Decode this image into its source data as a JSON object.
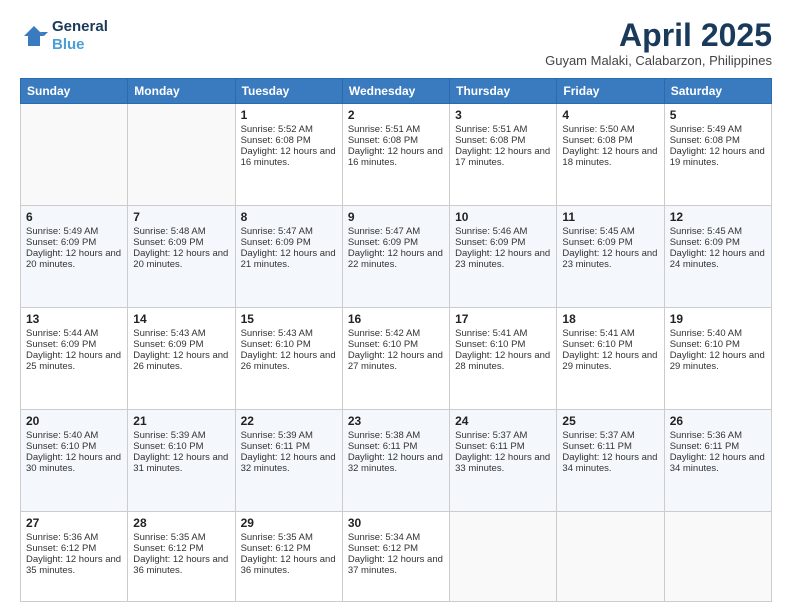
{
  "header": {
    "logo_line1": "General",
    "logo_line2": "Blue",
    "month": "April 2025",
    "location": "Guyam Malaki, Calabarzon, Philippines"
  },
  "days_of_week": [
    "Sunday",
    "Monday",
    "Tuesday",
    "Wednesday",
    "Thursday",
    "Friday",
    "Saturday"
  ],
  "weeks": [
    [
      {
        "day": "",
        "info": ""
      },
      {
        "day": "",
        "info": ""
      },
      {
        "day": "1",
        "info": "Sunrise: 5:52 AM\nSunset: 6:08 PM\nDaylight: 12 hours and 16 minutes."
      },
      {
        "day": "2",
        "info": "Sunrise: 5:51 AM\nSunset: 6:08 PM\nDaylight: 12 hours and 16 minutes."
      },
      {
        "day": "3",
        "info": "Sunrise: 5:51 AM\nSunset: 6:08 PM\nDaylight: 12 hours and 17 minutes."
      },
      {
        "day": "4",
        "info": "Sunrise: 5:50 AM\nSunset: 6:08 PM\nDaylight: 12 hours and 18 minutes."
      },
      {
        "day": "5",
        "info": "Sunrise: 5:49 AM\nSunset: 6:08 PM\nDaylight: 12 hours and 19 minutes."
      }
    ],
    [
      {
        "day": "6",
        "info": "Sunrise: 5:49 AM\nSunset: 6:09 PM\nDaylight: 12 hours and 20 minutes."
      },
      {
        "day": "7",
        "info": "Sunrise: 5:48 AM\nSunset: 6:09 PM\nDaylight: 12 hours and 20 minutes."
      },
      {
        "day": "8",
        "info": "Sunrise: 5:47 AM\nSunset: 6:09 PM\nDaylight: 12 hours and 21 minutes."
      },
      {
        "day": "9",
        "info": "Sunrise: 5:47 AM\nSunset: 6:09 PM\nDaylight: 12 hours and 22 minutes."
      },
      {
        "day": "10",
        "info": "Sunrise: 5:46 AM\nSunset: 6:09 PM\nDaylight: 12 hours and 23 minutes."
      },
      {
        "day": "11",
        "info": "Sunrise: 5:45 AM\nSunset: 6:09 PM\nDaylight: 12 hours and 23 minutes."
      },
      {
        "day": "12",
        "info": "Sunrise: 5:45 AM\nSunset: 6:09 PM\nDaylight: 12 hours and 24 minutes."
      }
    ],
    [
      {
        "day": "13",
        "info": "Sunrise: 5:44 AM\nSunset: 6:09 PM\nDaylight: 12 hours and 25 minutes."
      },
      {
        "day": "14",
        "info": "Sunrise: 5:43 AM\nSunset: 6:09 PM\nDaylight: 12 hours and 26 minutes."
      },
      {
        "day": "15",
        "info": "Sunrise: 5:43 AM\nSunset: 6:10 PM\nDaylight: 12 hours and 26 minutes."
      },
      {
        "day": "16",
        "info": "Sunrise: 5:42 AM\nSunset: 6:10 PM\nDaylight: 12 hours and 27 minutes."
      },
      {
        "day": "17",
        "info": "Sunrise: 5:41 AM\nSunset: 6:10 PM\nDaylight: 12 hours and 28 minutes."
      },
      {
        "day": "18",
        "info": "Sunrise: 5:41 AM\nSunset: 6:10 PM\nDaylight: 12 hours and 29 minutes."
      },
      {
        "day": "19",
        "info": "Sunrise: 5:40 AM\nSunset: 6:10 PM\nDaylight: 12 hours and 29 minutes."
      }
    ],
    [
      {
        "day": "20",
        "info": "Sunrise: 5:40 AM\nSunset: 6:10 PM\nDaylight: 12 hours and 30 minutes."
      },
      {
        "day": "21",
        "info": "Sunrise: 5:39 AM\nSunset: 6:10 PM\nDaylight: 12 hours and 31 minutes."
      },
      {
        "day": "22",
        "info": "Sunrise: 5:39 AM\nSunset: 6:11 PM\nDaylight: 12 hours and 32 minutes."
      },
      {
        "day": "23",
        "info": "Sunrise: 5:38 AM\nSunset: 6:11 PM\nDaylight: 12 hours and 32 minutes."
      },
      {
        "day": "24",
        "info": "Sunrise: 5:37 AM\nSunset: 6:11 PM\nDaylight: 12 hours and 33 minutes."
      },
      {
        "day": "25",
        "info": "Sunrise: 5:37 AM\nSunset: 6:11 PM\nDaylight: 12 hours and 34 minutes."
      },
      {
        "day": "26",
        "info": "Sunrise: 5:36 AM\nSunset: 6:11 PM\nDaylight: 12 hours and 34 minutes."
      }
    ],
    [
      {
        "day": "27",
        "info": "Sunrise: 5:36 AM\nSunset: 6:12 PM\nDaylight: 12 hours and 35 minutes."
      },
      {
        "day": "28",
        "info": "Sunrise: 5:35 AM\nSunset: 6:12 PM\nDaylight: 12 hours and 36 minutes."
      },
      {
        "day": "29",
        "info": "Sunrise: 5:35 AM\nSunset: 6:12 PM\nDaylight: 12 hours and 36 minutes."
      },
      {
        "day": "30",
        "info": "Sunrise: 5:34 AM\nSunset: 6:12 PM\nDaylight: 12 hours and 37 minutes."
      },
      {
        "day": "",
        "info": ""
      },
      {
        "day": "",
        "info": ""
      },
      {
        "day": "",
        "info": ""
      }
    ]
  ]
}
